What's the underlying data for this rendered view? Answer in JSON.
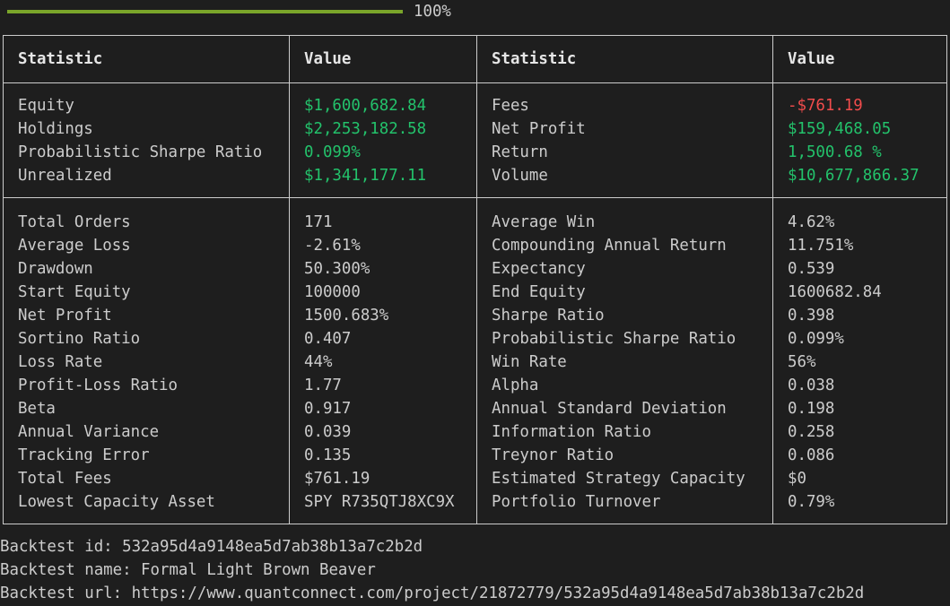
{
  "progress": {
    "percent_label": "100%",
    "fraction": 1.0,
    "bar_color": "#7aa52a"
  },
  "headers": {
    "stat1": "Statistic",
    "value1": "Value",
    "stat2": "Statistic",
    "value2": "Value"
  },
  "summary": [
    {
      "left_label": "Equity",
      "left_value": "$1,600,682.84",
      "left_tone": "pos",
      "right_label": "Fees",
      "right_value": "-$761.19",
      "right_tone": "neg"
    },
    {
      "left_label": "Holdings",
      "left_value": "$2,253,182.58",
      "left_tone": "pos",
      "right_label": "Net Profit",
      "right_value": "$159,468.05",
      "right_tone": "pos"
    },
    {
      "left_label": "Probabilistic Sharpe Ratio",
      "left_value": "0.099%",
      "left_tone": "pos",
      "right_label": "Return",
      "right_value": "1,500.68 %",
      "right_tone": "pos"
    },
    {
      "left_label": "Unrealized",
      "left_value": "$1,341,177.11",
      "left_tone": "pos",
      "right_label": "Volume",
      "right_value": "$10,677,866.37",
      "right_tone": "pos"
    }
  ],
  "statistics": [
    {
      "left_label": "Total Orders",
      "left_value": "171",
      "right_label": "Average Win",
      "right_value": "4.62%"
    },
    {
      "left_label": "Average Loss",
      "left_value": "-2.61%",
      "right_label": "Compounding Annual Return",
      "right_value": "11.751%"
    },
    {
      "left_label": "Drawdown",
      "left_value": "50.300%",
      "right_label": "Expectancy",
      "right_value": "0.539"
    },
    {
      "left_label": "Start Equity",
      "left_value": "100000",
      "right_label": "End Equity",
      "right_value": "1600682.84"
    },
    {
      "left_label": "Net Profit",
      "left_value": "1500.683%",
      "right_label": "Sharpe Ratio",
      "right_value": "0.398"
    },
    {
      "left_label": "Sortino Ratio",
      "left_value": "0.407",
      "right_label": "Probabilistic Sharpe Ratio",
      "right_value": "0.099%"
    },
    {
      "left_label": "Loss Rate",
      "left_value": "44%",
      "right_label": "Win Rate",
      "right_value": "56%"
    },
    {
      "left_label": "Profit-Loss Ratio",
      "left_value": "1.77",
      "right_label": "Alpha",
      "right_value": "0.038"
    },
    {
      "left_label": "Beta",
      "left_value": "0.917",
      "right_label": "Annual Standard Deviation",
      "right_value": "0.198"
    },
    {
      "left_label": "Annual Variance",
      "left_value": "0.039",
      "right_label": "Information Ratio",
      "right_value": "0.258"
    },
    {
      "left_label": "Tracking Error",
      "left_value": "0.135",
      "right_label": "Treynor Ratio",
      "right_value": "0.086"
    },
    {
      "left_label": "Total Fees",
      "left_value": "$761.19",
      "right_label": "Estimated Strategy Capacity",
      "right_value": "$0"
    },
    {
      "left_label": "Lowest Capacity Asset",
      "left_value": "SPY R735QTJ8XC9X",
      "right_label": "Portfolio Turnover",
      "right_value": "0.79%"
    }
  ],
  "footer": {
    "id_line": "Backtest id: 532a95d4a9148ea5d7ab38b13a7c2b2d",
    "name_line": "Backtest name: Formal Light Brown Beaver",
    "url_line": "Backtest url: https://www.quantconnect.com/project/21872779/532a95d4a9148ea5d7ab38b13a7c2b2d"
  },
  "colors": {
    "background": "#1e1e1e",
    "text": "#cccccc",
    "positive": "#23c26b",
    "negative": "#f14c4c"
  }
}
